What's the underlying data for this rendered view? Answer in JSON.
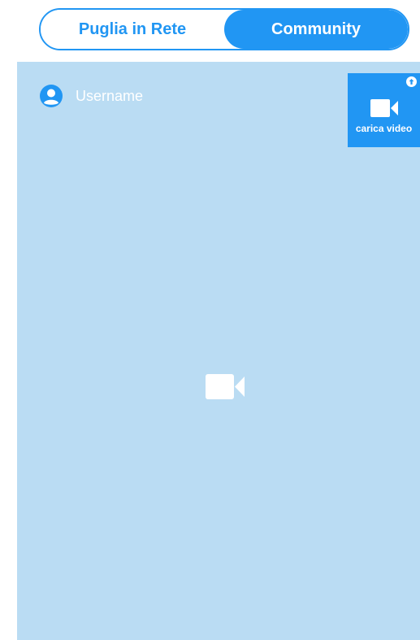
{
  "tabs": [
    {
      "label": "Puglia in Rete",
      "active": false
    },
    {
      "label": "Community",
      "active": true
    }
  ],
  "video": {
    "username": "Username",
    "upload_label": "carica video",
    "icons": {
      "user": "user-circle-icon",
      "upload_arrow": "upload-arrow-icon",
      "upload_camera": "video-camera-icon",
      "placeholder": "video-camera-icon"
    }
  },
  "colors": {
    "accent": "#2196f3",
    "video_background": "#badcf3",
    "text_on_accent": "#ffffff"
  }
}
